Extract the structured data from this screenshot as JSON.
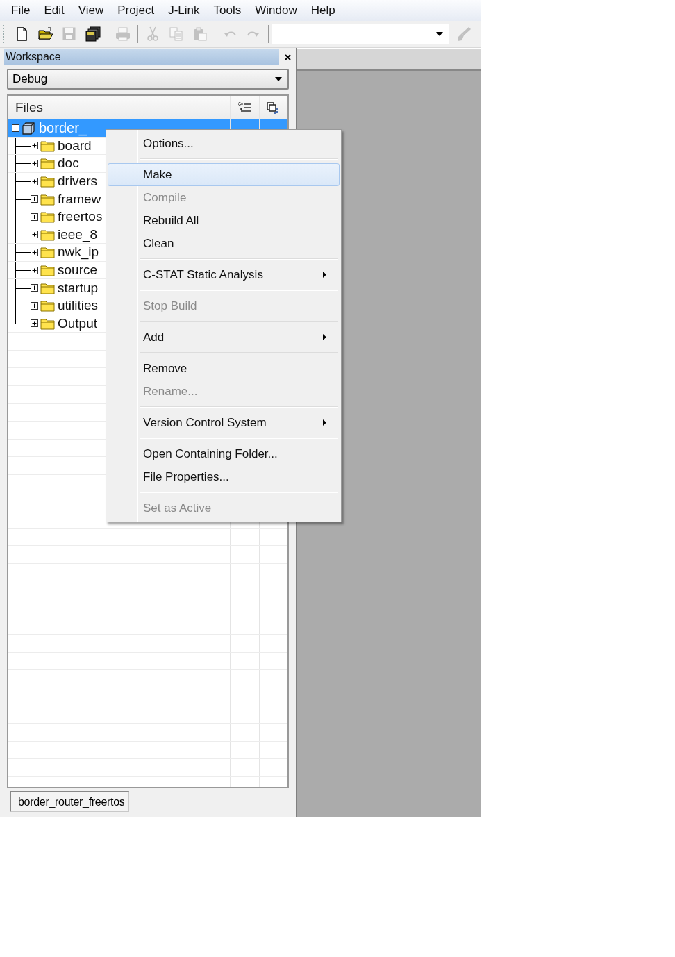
{
  "menu_bar": [
    "File",
    "Edit",
    "View",
    "Project",
    "J-Link",
    "Tools",
    "Window",
    "Help"
  ],
  "toolbar": [
    {
      "kind": "new",
      "disabled": false
    },
    {
      "kind": "open",
      "disabled": false
    },
    {
      "kind": "save",
      "disabled": true
    },
    {
      "kind": "save_all",
      "disabled": false
    },
    {
      "kind": "sep"
    },
    {
      "kind": "print",
      "disabled": true
    },
    {
      "kind": "sep"
    },
    {
      "kind": "cut",
      "disabled": true
    },
    {
      "kind": "copy",
      "disabled": true
    },
    {
      "kind": "paste",
      "disabled": true
    },
    {
      "kind": "sep"
    },
    {
      "kind": "undo",
      "disabled": true
    },
    {
      "kind": "redo",
      "disabled": true
    },
    {
      "kind": "sep"
    },
    {
      "kind": "combo"
    },
    {
      "kind": "brush",
      "disabled": true
    }
  ],
  "workspace": {
    "title": "Workspace",
    "configuration": "Debug",
    "files_header": "Files",
    "project": {
      "name": "border_",
      "selected": true,
      "expanded": true,
      "children": [
        {
          "name": "board",
          "expanded": false
        },
        {
          "name": "doc",
          "expanded": false
        },
        {
          "name": "drivers",
          "expanded": false
        },
        {
          "name": "framew",
          "expanded": false
        },
        {
          "name": "freertos",
          "expanded": false
        },
        {
          "name": "ieee_8",
          "expanded": false
        },
        {
          "name": "nwk_ip",
          "expanded": false
        },
        {
          "name": "source",
          "expanded": false
        },
        {
          "name": "startup",
          "expanded": false
        },
        {
          "name": "utilities",
          "expanded": false
        },
        {
          "name": "Output",
          "expanded": false
        }
      ]
    },
    "tab": "border_router_freertos"
  },
  "context_menu": {
    "groups": [
      [
        {
          "label": "Options...",
          "disabled": false,
          "selected": false,
          "submenu": false
        }
      ],
      [
        {
          "label": "Make",
          "disabled": false,
          "selected": true,
          "submenu": false
        },
        {
          "label": "Compile",
          "disabled": true,
          "selected": false,
          "submenu": false
        },
        {
          "label": "Rebuild All",
          "disabled": false,
          "selected": false,
          "submenu": false
        },
        {
          "label": "Clean",
          "disabled": false,
          "selected": false,
          "submenu": false
        }
      ],
      [
        {
          "label": "C-STAT Static Analysis",
          "disabled": false,
          "selected": false,
          "submenu": true
        }
      ],
      [
        {
          "label": "Stop Build",
          "disabled": true,
          "selected": false,
          "submenu": false
        }
      ],
      [
        {
          "label": "Add",
          "disabled": false,
          "selected": false,
          "submenu": true
        }
      ],
      [
        {
          "label": "Remove",
          "disabled": false,
          "selected": false,
          "submenu": false
        },
        {
          "label": "Rename...",
          "disabled": true,
          "selected": false,
          "submenu": false
        }
      ],
      [
        {
          "label": "Version Control System",
          "disabled": false,
          "selected": false,
          "submenu": true
        }
      ],
      [
        {
          "label": "Open Containing Folder...",
          "disabled": false,
          "selected": false,
          "submenu": false
        },
        {
          "label": "File Properties...",
          "disabled": false,
          "selected": false,
          "submenu": false
        }
      ],
      [
        {
          "label": "Set as Active",
          "disabled": true,
          "selected": false,
          "submenu": false
        }
      ]
    ]
  }
}
